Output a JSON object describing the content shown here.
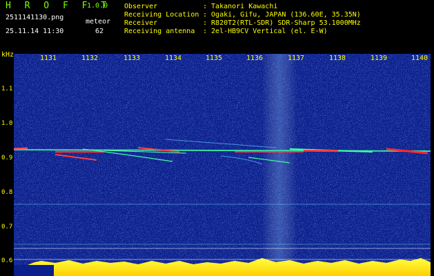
{
  "header": {
    "app_logo": "H R O F F T",
    "version": "1.0.0",
    "filename": "2511141130.png",
    "datetime": "25.11.14 11:30",
    "meteor_label": "meteor",
    "meteor_count": "62",
    "info": [
      {
        "label": "Observer",
        "value": ": Takanori Kawachi"
      },
      {
        "label": "Receiving Location",
        "value": ": Ogaki, Gifu, JAPAN (136.60E, 35.35N)"
      },
      {
        "label": "Receiver",
        "value": ": R820T2(RTL-SDR) SDR-Sharp 53.1000MHz"
      },
      {
        "label": "Receiving antenna",
        "value": ": 2el-HB9CV Vertical (el. E-W)"
      }
    ]
  },
  "spectrogram": {
    "y_unit": "kHz",
    "y_ticks": [
      "1.1",
      "1.0",
      "0.9",
      "0.8",
      "0.7",
      "0.6"
    ],
    "x_ticks": [
      "1131",
      "1132",
      "1133",
      "1134",
      "1135",
      "1136",
      "1137",
      "1138",
      "1139",
      "1140"
    ],
    "colors": {
      "background": "#0a1e8c",
      "axis_text": "#ffff00",
      "logo": "#7fff00",
      "signal": "#ff3030",
      "trace": "#40ffa0"
    }
  }
}
